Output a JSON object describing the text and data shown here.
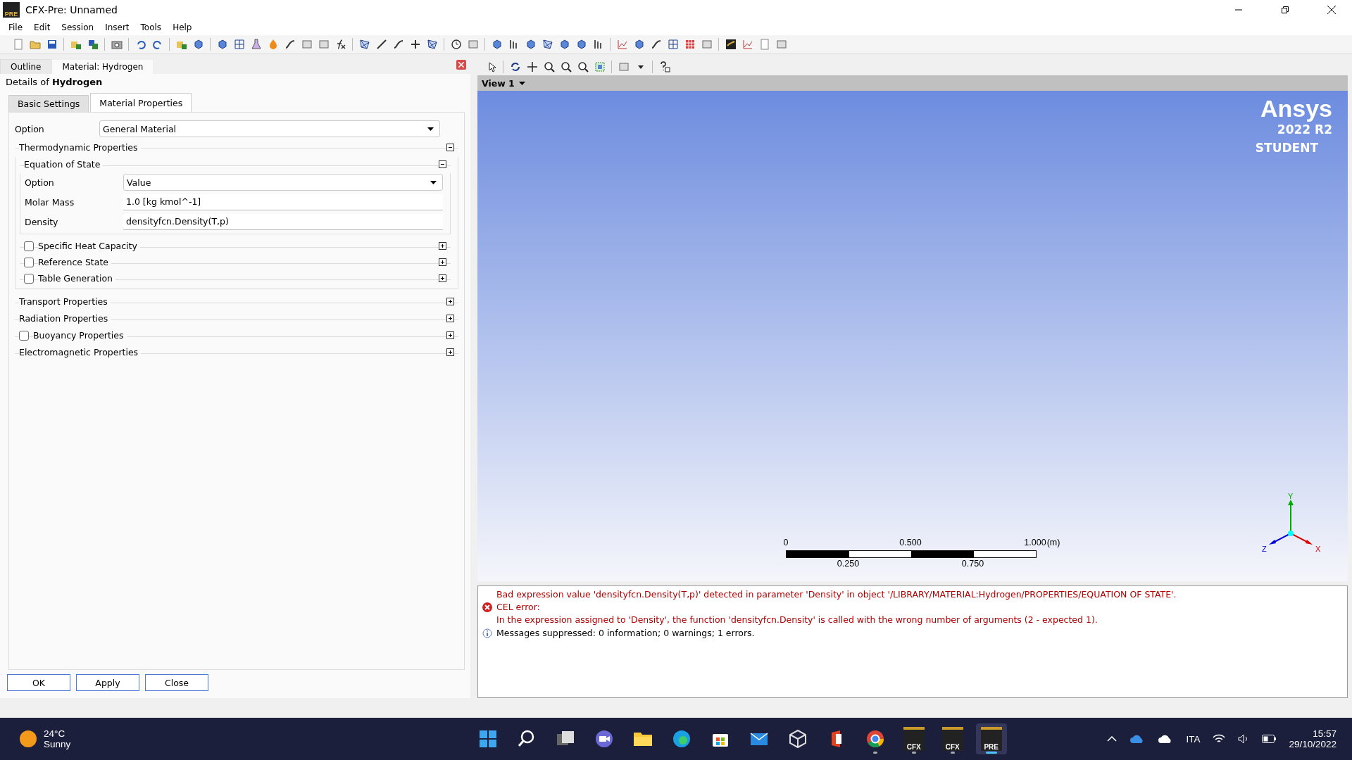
{
  "window": {
    "title": "CFX-Pre: Unnamed",
    "app_icon_label": "PRE"
  },
  "menu": [
    "File",
    "Edit",
    "Session",
    "Insert",
    "Tools",
    "Help"
  ],
  "panel_tabs": [
    {
      "label": "Outline",
      "selected": false
    },
    {
      "label": "Material: Hydrogen",
      "selected": true
    }
  ],
  "details_heading": "Details of **Hydrogen**",
  "sub_tabs": [
    {
      "label": "Basic Settings",
      "selected": false
    },
    {
      "label": "Material Properties",
      "selected": true
    }
  ],
  "material_properties": {
    "option": {
      "label": "Option",
      "value": "General Material"
    },
    "sections": [
      {
        "kind": "group",
        "label": "Thermodynamic Properties",
        "expanded": true,
        "children": [
          {
            "kind": "group",
            "label": "Equation of State",
            "expanded": true,
            "fields": [
              {
                "kind": "dropdown",
                "label": "Option",
                "value": "Value"
              },
              {
                "kind": "text",
                "label": "Molar Mass",
                "value": "1.0 [kg kmol^-1]"
              },
              {
                "kind": "text",
                "label": "Density",
                "value": "densityfcn.Density(T,p)"
              }
            ]
          },
          {
            "kind": "optional",
            "label": "Specific Heat Capacity",
            "checked": false,
            "expanded": false
          },
          {
            "kind": "optional",
            "label": "Reference State",
            "checked": false,
            "expanded": false
          },
          {
            "kind": "optional",
            "label": "Table Generation",
            "checked": false,
            "expanded": false
          }
        ]
      },
      {
        "kind": "group",
        "label": "Transport Properties",
        "expanded": false
      },
      {
        "kind": "group",
        "label": "Radiation Properties",
        "expanded": false
      },
      {
        "kind": "optional",
        "label": "Buoyancy Properties",
        "checked": false,
        "expanded": false
      },
      {
        "kind": "group",
        "label": "Electromagnetic Properties",
        "expanded": false
      }
    ]
  },
  "panel_buttons": [
    "OK",
    "Apply",
    "Close"
  ],
  "viewer": {
    "view_label": "View 1",
    "logo": {
      "brand": "Ansys",
      "version": "2022 R2",
      "edition": "STUDENT"
    },
    "scale": {
      "top_labels": [
        "0",
        "0.500",
        "1.000"
      ],
      "unit": "(m)",
      "bottom_labels": [
        "0.250",
        "0.750"
      ]
    },
    "axes": [
      "Y",
      "Z",
      "X"
    ]
  },
  "messages": [
    {
      "kind": "error",
      "lines": [
        "Bad expression value 'densityfcn.Density(T,p)' detected in parameter 'Density' in object '/LIBRARY/MATERIAL:Hydrogen/PROPERTIES/EQUATION OF STATE'.",
        "CEL error:",
        "In the expression assigned to 'Density', the function 'densityfcn.Density' is called with the wrong number of arguments (2 - expected 1)."
      ]
    },
    {
      "kind": "info",
      "lines": [
        "Messages suppressed: 0 information; 0 warnings; 1 errors."
      ]
    }
  ],
  "taskbar": {
    "weather": {
      "temperature": "24°C",
      "condition": "Sunny"
    },
    "apps": [
      {
        "kind": "start",
        "running": false,
        "selected": false
      },
      {
        "kind": "search",
        "running": false,
        "selected": false
      },
      {
        "kind": "taskview",
        "running": false,
        "selected": false
      },
      {
        "kind": "chat",
        "running": false,
        "selected": false
      },
      {
        "kind": "folder",
        "running": false,
        "selected": false
      },
      {
        "kind": "browser",
        "running": false,
        "selected": false
      },
      {
        "kind": "store",
        "running": false,
        "selected": false
      },
      {
        "kind": "mail",
        "running": false,
        "selected": false
      },
      {
        "kind": "cube",
        "running": false,
        "selected": false
      },
      {
        "kind": "office",
        "running": false,
        "selected": false
      },
      {
        "kind": "chrome",
        "running": true,
        "selected": false
      },
      {
        "kind": "labeled",
        "label": "CFX",
        "running": true,
        "selected": false
      },
      {
        "kind": "labeled",
        "label": "CFX",
        "running": true,
        "selected": false
      },
      {
        "kind": "labeled",
        "label": "PRE",
        "running": true,
        "selected": true
      }
    ],
    "language": "ITA",
    "time": "15:57",
    "date": "29/10/2022"
  }
}
